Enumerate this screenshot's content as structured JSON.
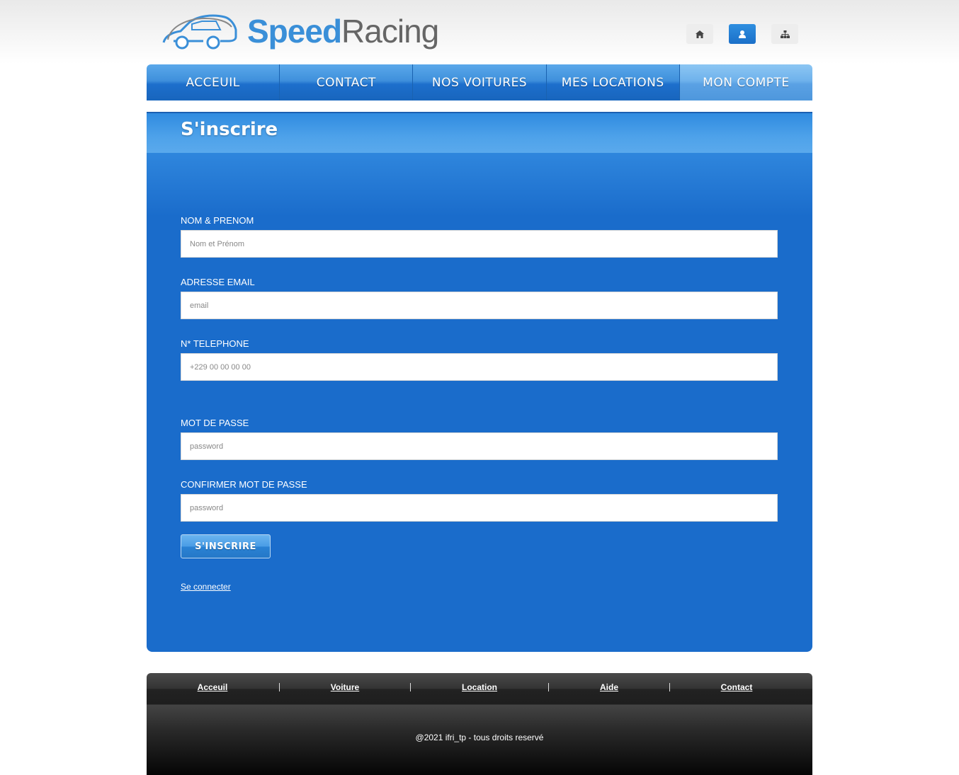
{
  "header": {
    "logo": {
      "speed": "Speed",
      "racing": "Racing",
      "icon": "car-outline-icon"
    },
    "icons": [
      {
        "name": "home-icon"
      },
      {
        "name": "user-icon",
        "active": true
      },
      {
        "name": "sitemap-icon"
      }
    ]
  },
  "nav": {
    "items": [
      {
        "label": "ACCEUIL"
      },
      {
        "label": "CONTACT"
      },
      {
        "label": "NOS VOITURES"
      },
      {
        "label": "MES LOCATIONS"
      },
      {
        "label": "MON COMPTE",
        "active": true
      }
    ]
  },
  "form": {
    "title": "S'inscrire",
    "fields": {
      "name": {
        "label": "NOM & PRENOM",
        "placeholder": "Nom et Prénom"
      },
      "email": {
        "label": "ADRESSE EMAIL",
        "placeholder": "email"
      },
      "phone": {
        "label": "N* TELEPHONE",
        "placeholder": "+229 00 00 00 00"
      },
      "password": {
        "label": "MOT DE PASSE",
        "placeholder": "password"
      },
      "confirm": {
        "label": "CONFIRMER MOT DE PASSE",
        "placeholder": "password"
      }
    },
    "submit_label": "S'INSCRIRE",
    "login_link": "Se connecter"
  },
  "footer": {
    "links": [
      "Acceuil",
      "Voiture",
      "Location",
      "Aide",
      "Contact"
    ],
    "copyright": "@2021 ifri_tp - tous droits reservé"
  },
  "colors": {
    "panel": "#1a6ccb",
    "nav_blue": "#1d6fcc",
    "nav_active": "#6fb2ec",
    "logo_speed": "#3a8fd8",
    "logo_racing": "#666666"
  }
}
